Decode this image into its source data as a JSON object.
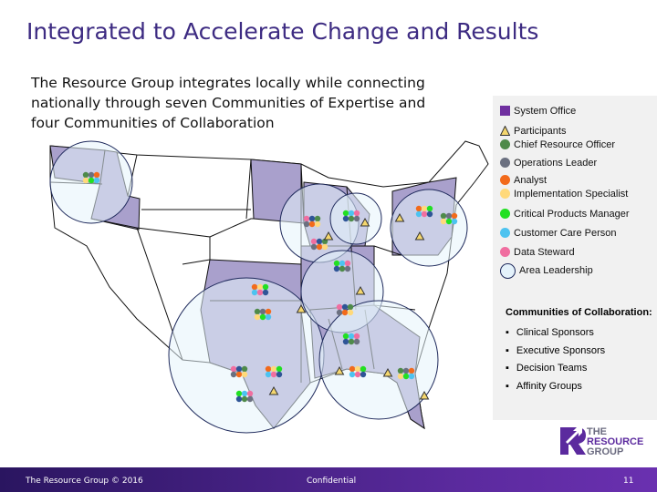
{
  "title": "Integrated to Accelerate Change and Results",
  "intro": "The Resource Group integrates locally while connecting nationally through seven Communities of Expertise and four Communities of Collaboration",
  "legend": {
    "items": [
      {
        "label": "System Office",
        "shape": "square",
        "color": "#7030a0"
      },
      {
        "label": "Participants",
        "shape": "triangle",
        "color": "#f5d76e"
      },
      {
        "label": "Chief Resource Officer",
        "shape": "dot",
        "color": "#4e8a4a"
      },
      {
        "label": "Operations Leader",
        "shape": "dot",
        "color": "#6b7080"
      },
      {
        "label": "Analyst",
        "shape": "dot",
        "color": "#f26a1b"
      },
      {
        "label": "Implementation Specialist",
        "shape": "dot",
        "color": "#ffd97a"
      },
      {
        "label": "Critical Products Manager",
        "shape": "dot",
        "color": "#22e022"
      },
      {
        "label": "Customer Care Person",
        "shape": "dot",
        "color": "#4dc3f0"
      },
      {
        "label": "Data Steward",
        "shape": "dot",
        "color": "#f06ea0"
      },
      {
        "label": "Area Leadership",
        "shape": "circle",
        "color": "#e4f2fb"
      }
    ],
    "communities_heading": "Communities of Collaboration:",
    "communities": [
      "Clinical Sponsors",
      "Executive Sponsors",
      "Decision Teams",
      "Affinity Groups"
    ]
  },
  "logo": {
    "line1": "THE",
    "line2": "RESOURCE",
    "line3": "GROUP",
    "color": "#5b2a9e"
  },
  "footer": {
    "left": "The Resource Group © 2016",
    "center": "Confidential",
    "page": "11"
  },
  "colors": {
    "region": "#a9a0cc",
    "area": "#e6f4fc",
    "area_stroke": "#1f2a5c"
  }
}
